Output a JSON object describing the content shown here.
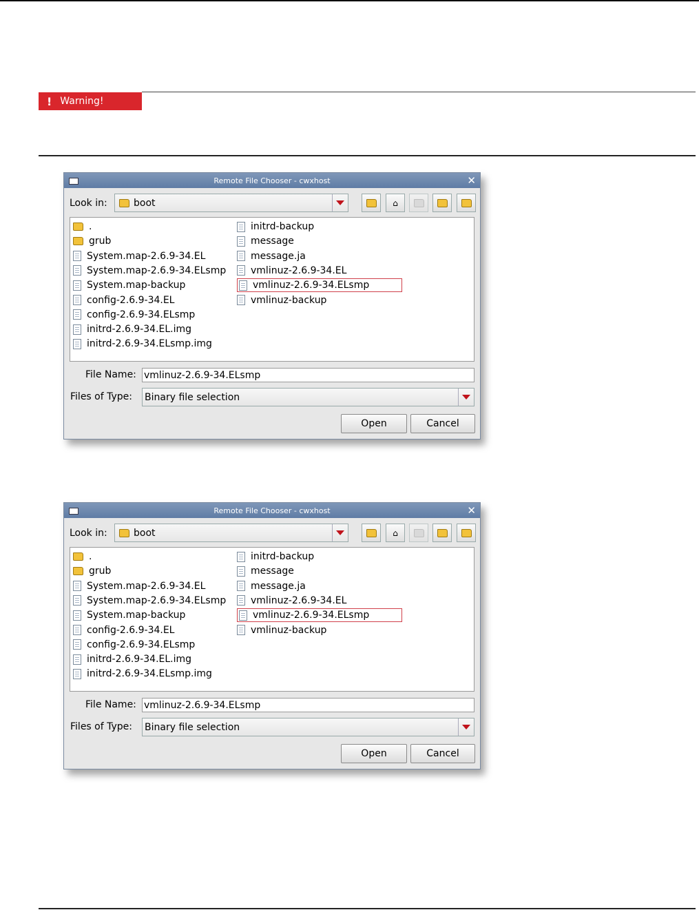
{
  "warning": {
    "label": "Warning!",
    "icon": "exclamation-icon"
  },
  "dialogs": [
    {
      "title": "Remote File Chooser - cwxhost",
      "look_in_label": "Look in:",
      "look_in_value": "boot",
      "files": [
        {
          "name": ".",
          "type": "folder"
        },
        {
          "name": "grub",
          "type": "folder"
        },
        {
          "name": "System.map-2.6.9-34.EL",
          "type": "file"
        },
        {
          "name": "System.map-2.6.9-34.ELsmp",
          "type": "file"
        },
        {
          "name": "System.map-backup",
          "type": "file"
        },
        {
          "name": "config-2.6.9-34.EL",
          "type": "file"
        },
        {
          "name": "config-2.6.9-34.ELsmp",
          "type": "file"
        },
        {
          "name": "initrd-2.6.9-34.EL.img",
          "type": "file"
        },
        {
          "name": "initrd-2.6.9-34.ELsmp.img",
          "type": "file"
        },
        {
          "name": "initrd-backup",
          "type": "file"
        },
        {
          "name": "message",
          "type": "file"
        },
        {
          "name": "message.ja",
          "type": "file"
        },
        {
          "name": "vmlinuz-2.6.9-34.EL",
          "type": "file"
        },
        {
          "name": "vmlinuz-2.6.9-34.ELsmp",
          "type": "file",
          "selected": true
        },
        {
          "name": "vmlinuz-backup",
          "type": "file"
        }
      ],
      "file_name_label": "File Name:",
      "file_name_value": "vmlinuz-2.6.9-34.ELsmp",
      "files_of_type_label": "Files of Type:",
      "files_of_type_value": "Binary file selection",
      "open_label": "Open",
      "cancel_label": "Cancel"
    },
    {
      "title": "Remote File Chooser - cwxhost",
      "look_in_label": "Look in:",
      "look_in_value": "boot",
      "files": [
        {
          "name": ".",
          "type": "folder"
        },
        {
          "name": "grub",
          "type": "folder"
        },
        {
          "name": "System.map-2.6.9-34.EL",
          "type": "file"
        },
        {
          "name": "System.map-2.6.9-34.ELsmp",
          "type": "file"
        },
        {
          "name": "System.map-backup",
          "type": "file"
        },
        {
          "name": "config-2.6.9-34.EL",
          "type": "file"
        },
        {
          "name": "config-2.6.9-34.ELsmp",
          "type": "file"
        },
        {
          "name": "initrd-2.6.9-34.EL.img",
          "type": "file"
        },
        {
          "name": "initrd-2.6.9-34.ELsmp.img",
          "type": "file"
        },
        {
          "name": "initrd-backup",
          "type": "file"
        },
        {
          "name": "message",
          "type": "file"
        },
        {
          "name": "message.ja",
          "type": "file"
        },
        {
          "name": "vmlinuz-2.6.9-34.EL",
          "type": "file"
        },
        {
          "name": "vmlinuz-2.6.9-34.ELsmp",
          "type": "file",
          "selected": true
        },
        {
          "name": "vmlinuz-backup",
          "type": "file"
        }
      ],
      "file_name_label": "File Name:",
      "file_name_value": "vmlinuz-2.6.9-34.ELsmp",
      "files_of_type_label": "Files of Type:",
      "files_of_type_value": "Binary file selection",
      "open_label": "Open",
      "cancel_label": "Cancel"
    }
  ],
  "colors": {
    "warning_red": "#d9262c",
    "title_blue": "#6d88b0",
    "selection_border": "#d0404a",
    "combo_arrow": "#c0141c"
  }
}
